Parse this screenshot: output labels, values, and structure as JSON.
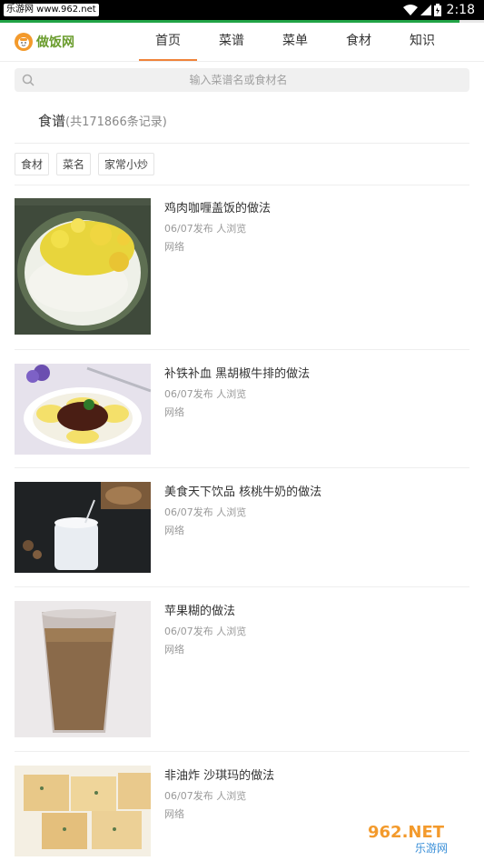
{
  "status_bar": {
    "site_tag": "乐游网 www.962.net",
    "time": "2:18"
  },
  "load_progress": 0.95,
  "header": {
    "logo_text": "做饭网",
    "tabs": [
      {
        "label": "首页",
        "active": true
      },
      {
        "label": "菜谱",
        "active": false
      },
      {
        "label": "菜单",
        "active": false
      },
      {
        "label": "食材",
        "active": false
      },
      {
        "label": "知识",
        "active": false
      }
    ]
  },
  "search": {
    "placeholder": "输入菜谱名或食材名"
  },
  "section": {
    "title": "食谱",
    "count": "(共171866条记录)"
  },
  "filter_tags": [
    "食材",
    "菜名",
    "家常小炒"
  ],
  "recipes": [
    {
      "title": "鸡肉咖喱盖饭的做法",
      "date_line": "06/07发布 人浏览",
      "source": "网络",
      "image": "curry-rice"
    },
    {
      "title": "补铁补血 黑胡椒牛排的做法",
      "date_line": "06/07发布 人浏览",
      "source": "网络",
      "image": "steak"
    },
    {
      "title": "美食天下饮品 核桃牛奶的做法",
      "date_line": "06/07发布 人浏览",
      "source": "网络",
      "image": "walnut-milk"
    },
    {
      "title": "苹果糊的做法",
      "date_line": "06/07发布 人浏览",
      "source": "网络",
      "image": "apple-paste"
    },
    {
      "title": "非油炸 沙琪玛的做法",
      "date_line": "06/07发布 人浏览",
      "source": "网络",
      "image": "sachima"
    }
  ],
  "watermark": {
    "top": "962.NET",
    "bottom": "乐游网"
  },
  "colors": {
    "accent": "#f0833a",
    "logo": "#6a9c2d",
    "progress": "#22a447"
  }
}
